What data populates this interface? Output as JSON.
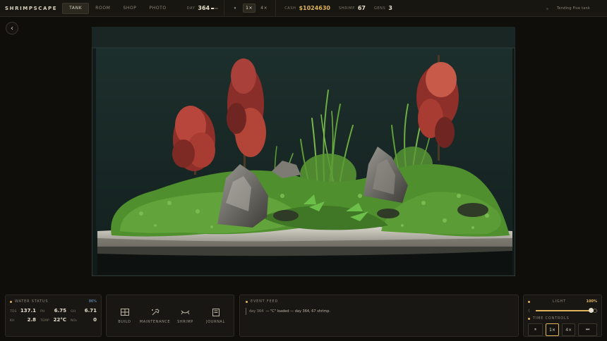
{
  "app": {
    "title": "SHRIMPSCAPE"
  },
  "nav": {
    "tabs": [
      {
        "label": "TANK",
        "active": true
      },
      {
        "label": "ROOM",
        "active": false
      },
      {
        "label": "SHOP",
        "active": false
      },
      {
        "label": "PHOTO",
        "active": false
      }
    ]
  },
  "stats": {
    "day_label": "DAY",
    "day": "364",
    "day_progress": 0.4,
    "cash_label": "CASH",
    "cash": "$1024630",
    "shrimp_label": "SHRIMP",
    "shrimp": "67",
    "gens_label": "GENS",
    "gens": "3"
  },
  "speed": {
    "pause": "⏸",
    "x1": "1×",
    "x4": "4×",
    "active": "1×"
  },
  "status_text": "Tending Five tank",
  "water_status": {
    "title": "WATER STATUS",
    "percent": "86%",
    "rows": [
      {
        "k1": "TDS",
        "v1": "137.1",
        "k2": "PH",
        "v2": "6.75",
        "k3": "GH",
        "v3": "6.71"
      },
      {
        "k1": "KH",
        "v1": "2.8",
        "k2": "TEMP",
        "v2": "22°C",
        "k3": "NO₃",
        "v3": "0"
      }
    ]
  },
  "actions": {
    "build": "BUILD",
    "maintenance": "MAINTENANCE",
    "shrimp": "SHRIMP",
    "journal": "JOURNAL"
  },
  "event_feed": {
    "title": "EVENT FEED",
    "entries": [
      {
        "day": "day 364",
        "text": "— \"C\" loaded — day 364, 67 shrimp."
      }
    ]
  },
  "light": {
    "title": "LIGHT",
    "percent": "100%",
    "level": 1.0
  },
  "time_controls": {
    "title": "TIME CONTROLS",
    "pause": "⏸",
    "x1": "1×",
    "x4": "4×",
    "ff": "⏭",
    "active": "1×"
  },
  "colors": {
    "accent": "#e0b25a",
    "panel": "#181713",
    "water": "#1c2c2a",
    "moss": "#4f8f2e",
    "red_plant": "#b9463c"
  }
}
